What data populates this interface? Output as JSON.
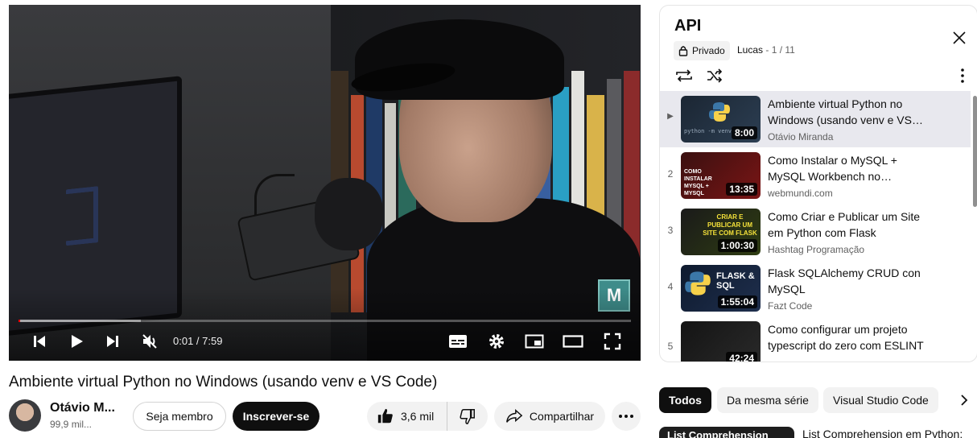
{
  "player": {
    "time_display": "0:01 / 7:59",
    "progress_fraction": 0.002,
    "loaded_fraction": 0.2,
    "watermark_letter": "M",
    "colors": {
      "progress": "#ff0000"
    },
    "icons": [
      "previous-icon",
      "play-icon",
      "next-icon",
      "mute-icon",
      "subtitles-icon",
      "settings-icon",
      "miniplayer-icon",
      "theater-icon",
      "fullscreen-icon"
    ]
  },
  "video": {
    "title": "Ambiente virtual Python no Windows (usando venv e VS Code)",
    "channel": "Otávio M...",
    "subscribers": "99,9 mil...",
    "member_label": "Seja membro",
    "subscribe_label": "Inscrever-se",
    "likes": "3,6 mil",
    "share_label": "Compartilhar"
  },
  "playlist": {
    "title": "API",
    "privacy": "Privado",
    "owner": "Lucas",
    "position": "- 1 / 11",
    "items": [
      {
        "index": "▶",
        "title": "Ambiente virtual Python no Windows (usando venv e VS Code)",
        "channel": "Otávio Miranda",
        "duration": "8:00",
        "thumb_text": "python -m venv venv",
        "active": true
      },
      {
        "index": "2",
        "title": "Como Instalar o MySQL + MySQL Workbench no Windows",
        "channel": "webmundi.com",
        "duration": "13:35",
        "thumb_text": "COMO INSTALAR MYSQL + MYSQL"
      },
      {
        "index": "3",
        "title": "Como Criar e Publicar um Site em Python com Flask",
        "channel": "Hashtag Programação",
        "duration": "1:00:30",
        "thumb_text": "CRIAR E PUBLICAR UM SITE COM FLASK"
      },
      {
        "index": "4",
        "title": "Flask SQLAlchemy CRUD con MySQL",
        "channel": "Fazt Code",
        "duration": "1:55:04",
        "thumb_text": "FLASK & SQL"
      },
      {
        "index": "5",
        "title": "Como configurar um projeto typescript do zero com ESLINT",
        "channel": "",
        "duration": "42:24",
        "thumb_text": ""
      }
    ]
  },
  "chips": [
    "Todos",
    "Da mesma série",
    "Visual Studio Code"
  ],
  "recommended": {
    "title": "List Comprehension em Python:",
    "thumb_text": "List Comprehension"
  }
}
